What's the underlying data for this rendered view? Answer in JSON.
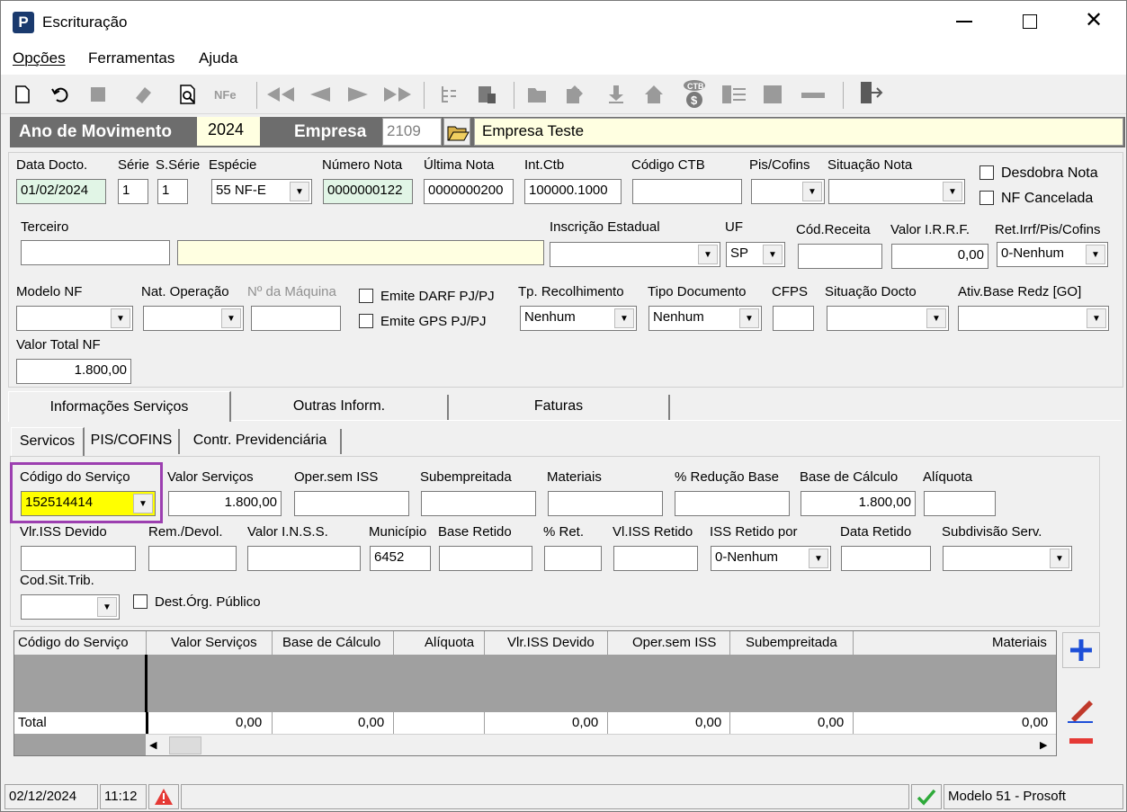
{
  "window": {
    "title": "Escrituração",
    "app_icon": "P"
  },
  "menu": {
    "items": [
      "Opções",
      "Ferramentas",
      "Ajuda"
    ]
  },
  "header": {
    "ano_label": "Ano de Movimento",
    "ano_value": "2024",
    "empresa_label": "Empresa",
    "empresa_code": "2109",
    "empresa_name": "Empresa Teste"
  },
  "form": {
    "data_docto_label": "Data Docto.",
    "data_docto": "01/02/2024",
    "serie_label": "Série",
    "serie": "1",
    "sserie_label": "S.Série",
    "sserie": "1",
    "especie_label": "Espécie",
    "especie": "55 NF-E",
    "numero_nota_label": "Número Nota",
    "numero_nota": "0000000122",
    "ultima_nota_label": "Última Nota",
    "ultima_nota": "0000000200",
    "int_ctb_label": "Int.Ctb",
    "int_ctb": "100000.1000",
    "codigo_ctb_label": "Código CTB",
    "pis_cofins_label": "Pis/Cofins",
    "situacao_nota_label": "Situação Nota",
    "desdobra_label": "Desdobra Nota",
    "nf_cancelada_label": "NF Cancelada",
    "terceiro_label": "Terceiro",
    "inscricao_label": "Inscrição Estadual",
    "uf_label": "UF",
    "uf": "SP",
    "cod_receita_label": "Cód.Receita",
    "valor_irrf_label": "Valor I.R.R.F.",
    "valor_irrf": "0,00",
    "ret_irrf_label": "Ret.Irrf/Pis/Cofins",
    "ret_irrf": "0-Nenhum",
    "modelo_nf_label": "Modelo NF",
    "nat_operacao_label": "Nat. Operação",
    "num_maquina_label": "Nº da Máquina",
    "emite_darf_label": "Emite DARF PJ/PJ",
    "emite_gps_label": "Emite GPS PJ/PJ",
    "tp_recolhimento_label": "Tp. Recolhimento",
    "tp_recolhimento": "Nenhum",
    "tipo_documento_label": "Tipo Documento",
    "tipo_documento": "Nenhum",
    "cfps_label": "CFPS",
    "situacao_docto_label": "Situação Docto",
    "ativ_base_label": "Ativ.Base Redz [GO]",
    "valor_total_label": "Valor Total NF",
    "valor_total": "1.800,00"
  },
  "tabs": [
    "Informações Serviços",
    "Outras Inform.",
    "Faturas"
  ],
  "subtabs": [
    "Servicos",
    "PIS/COFINS",
    "Contr. Previdenciária"
  ],
  "servicos": {
    "codigo_servico_label": "Código do Serviço",
    "codigo_servico": "152514414",
    "valor_servicos_label": "Valor Serviços",
    "valor_servicos": "1.800,00",
    "oper_sem_iss_label": "Oper.sem ISS",
    "subempreitada_label": "Subempreitada",
    "materiais_label": "Materiais",
    "reducao_base_label": "% Redução Base",
    "base_calculo_label": "Base de Cálculo",
    "base_calculo": "1.800,00",
    "aliquota_label": "Alíquota",
    "vlr_iss_devido_label": "Vlr.ISS Devido",
    "rem_devol_label": "Rem./Devol.",
    "valor_inss_label": "Valor I.N.S.S.",
    "municipio_label": "Município",
    "municipio": "6452",
    "base_retido_label": "Base Retido",
    "pct_ret_label": "% Ret.",
    "vl_iss_retido_label": "Vl.ISS Retido",
    "iss_retido_por_label": "ISS Retido por",
    "iss_retido_por": "0-Nenhum",
    "data_retido_label": "Data Retido",
    "subdivisao_label": "Subdivisão Serv.",
    "cod_sit_trib_label": "Cod.Sit.Trib.",
    "dest_org_label": "Dest.Órg. Público"
  },
  "grid": {
    "columns": [
      "Código do Serviço",
      "Valor Serviços",
      "Base de Cálculo",
      "Alíquota",
      "Vlr.ISS Devido",
      "Oper.sem ISS",
      "Subempreitada",
      "Materiais"
    ],
    "total_label": "Total",
    "totals": [
      "0,00",
      "0,00",
      "",
      "0,00",
      "0,00",
      "0,00",
      "0,00"
    ]
  },
  "status": {
    "date": "02/12/2024",
    "time": "11:12",
    "model": "Modelo 51 - Prosoft"
  },
  "colors": {
    "header_bar": "#6d6d6d",
    "yellow_field": "#ffff00",
    "light_yellow": "#ffffe1",
    "green_field": "#e1f5e6",
    "highlight_border": "#9c3fb0"
  }
}
